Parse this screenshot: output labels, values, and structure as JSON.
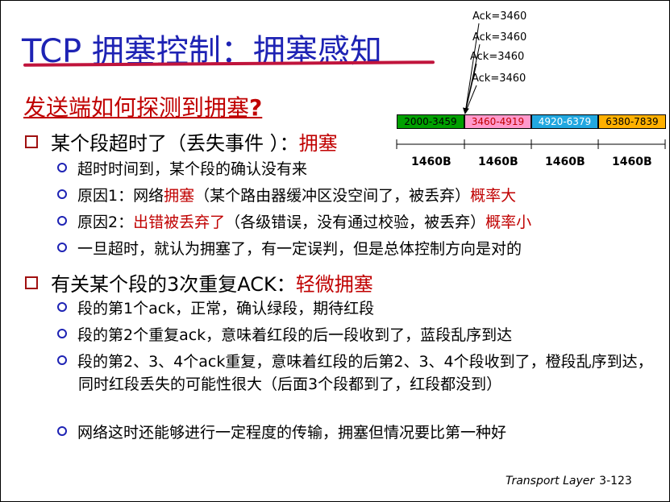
{
  "title": "TCP 拥塞控制：拥塞感知",
  "subtitle": {
    "text": "发送端如何探测到拥塞",
    "qmark": "?"
  },
  "bullet1": {
    "text": "某个段超时了（丢失事件 ）：",
    "highlight": "拥塞"
  },
  "bullet1_items": [
    {
      "text": "超时时间到，某个段的确认没有来"
    },
    {
      "pre": "原因1：网络",
      "red1": "拥塞",
      "mid": "（某个路由器缓冲区没空间了，被丢弃）",
      "red2": "概率大"
    },
    {
      "pre": "原因2：",
      "red1": "出错被丢弃了",
      "mid": "（各级错误，没有通过校验，被丢弃）",
      "red2": "概率小"
    },
    {
      "text": "一旦超时，就认为拥塞了，有一定误判，但是总体控制方向是对的"
    }
  ],
  "bullet2": {
    "text": "有关某个段的3次重复ACK：",
    "highlight": "轻微拥塞"
  },
  "bullet2_items": [
    {
      "text": "段的第1个ack，正常，确认绿段，期待红段"
    },
    {
      "text": "段的第2个重复ack，意味着红段的后一段收到了，蓝段乱序到达"
    },
    {
      "text": "段的第2、3、4个ack重复，意味着红段的后第2、3、4个段收到了，橙段乱序到达，同时红段丢失的可能性很大（后面3个段都到了，红段都没到）"
    },
    {
      "text": "网络这时还能够进行一定程度的传输，拥塞但情况要比第一种好"
    }
  ],
  "diagram": {
    "acks": [
      "Ack=3460",
      "Ack=3460",
      "Ack=3460",
      "Ack=3460"
    ],
    "segments": [
      {
        "label": "2000-3459",
        "color": "#00a000"
      },
      {
        "label": "3460-4919",
        "color": "#ff99cc"
      },
      {
        "label": "4920-6379",
        "color": "#22a8e0"
      },
      {
        "label": "6380-7839",
        "color": "#ffb000"
      }
    ],
    "lengths": [
      "1460B",
      "1460B",
      "1460B",
      "1460B"
    ]
  },
  "footer": {
    "label": "Transport Layer",
    "page": "3-123"
  }
}
